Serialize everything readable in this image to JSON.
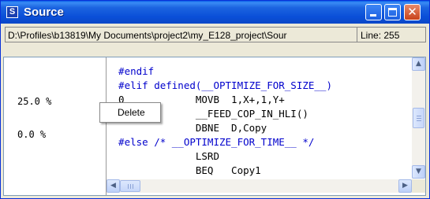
{
  "window": {
    "title": "Source",
    "app_icon_letter": "S",
    "close_glyph": "✕"
  },
  "pathbar": {
    "path": "D:\\Profiles\\b13819\\My Documents\\project2\\my_E128_project\\Sour",
    "line_label": "Line: 255"
  },
  "gutter": {
    "percentages": [
      "25.0 %",
      "0.0 %"
    ]
  },
  "code": {
    "lines": [
      "  #endif",
      "  #elif defined(__OPTIMIZE_FOR_SIZE__)",
      "  0            MOVB  1,X+,1,Y+",
      "               __FEED_COP_IN_HLI()",
      "               DBNE  D,Copy",
      "  #else /* __OPTIMIZE_FOR_TIME__ */",
      "               LSRD",
      "               BEQ   Copy1"
    ]
  },
  "context_menu": {
    "items": [
      "Delete"
    ]
  },
  "scroll": {
    "up": "▲",
    "down": "▼",
    "left": "◀",
    "right": "▶"
  },
  "colors": {
    "titlebar": "#0a4fd8",
    "keyword": "#0000cc"
  }
}
